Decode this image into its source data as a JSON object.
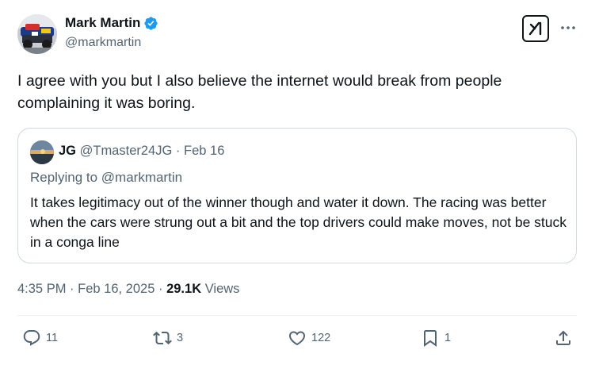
{
  "author": {
    "display_name": "Mark Martin",
    "handle": "@markmartin",
    "avatar_icon": "race-car-avatar",
    "verified_icon": "verified-badge-icon",
    "verified_color": "#1d9bf0"
  },
  "tweet": {
    "text": "I agree with you but I also believe the internet would break from people complaining it was boring."
  },
  "quoted": {
    "name": "JG",
    "handle": "@Tmaster24JG",
    "separator": "·",
    "date": "Feb 16",
    "replying_prefix": "Replying to ",
    "replying_handle": "@markmartin",
    "text": "It takes legitimacy out of the winner though and water it down. The racing was better when the cars were strung out a bit and the top drivers could make moves, not be stuck in a conga line"
  },
  "meta": {
    "time": "4:35 PM",
    "separator": "·",
    "date": "Feb 16, 2025",
    "views_count": "29.1K",
    "views_label": "Views"
  },
  "actions": {
    "replies": "11",
    "reposts": "3",
    "likes": "122",
    "bookmarks": "1"
  },
  "colors": {
    "text": "#0f1419",
    "secondary": "#536471",
    "border": "#cfd9de",
    "accent": "#1d9bf0"
  }
}
